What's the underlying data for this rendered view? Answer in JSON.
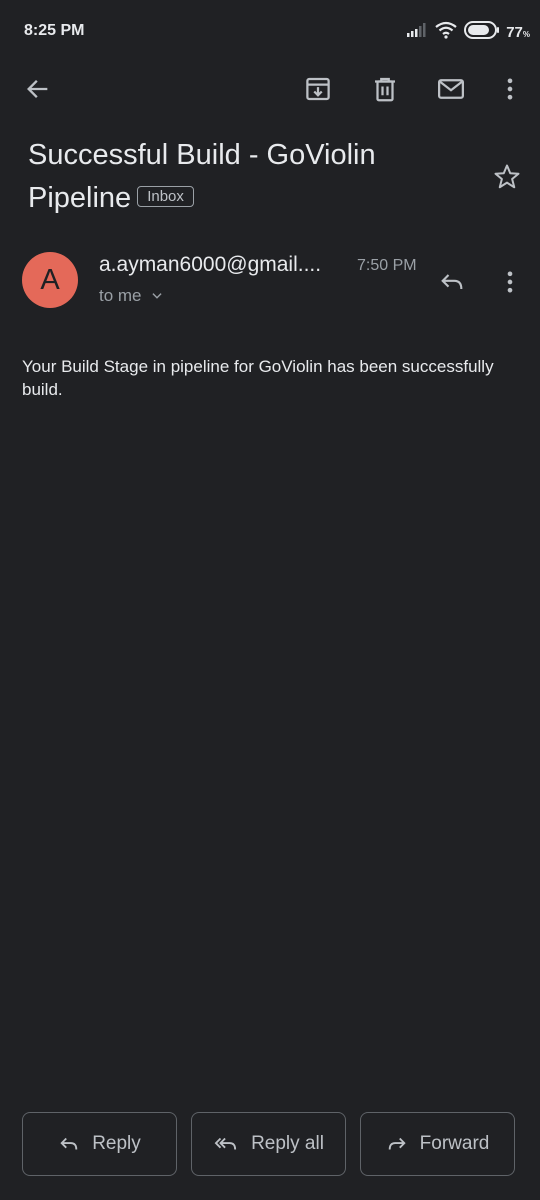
{
  "status_bar": {
    "time": "8:25 PM",
    "battery_percent": "77",
    "battery_unit": "%",
    "icons": [
      "signal-icon",
      "wifi-icon",
      "battery-icon"
    ]
  },
  "toolbar": {
    "icons": [
      "back-arrow-icon",
      "archive-icon",
      "delete-icon",
      "mark-unread-icon",
      "more-vert-icon"
    ]
  },
  "email": {
    "subject": "Successful Build - GoViolin Pipeline",
    "label": "Inbox",
    "avatar_letter": "A",
    "sender": "a.ayman6000@gmail....",
    "time": "7:50 PM",
    "recipient": "to me",
    "body": "Your Build Stage in pipeline for GoViolin has been successfully build."
  },
  "actions": {
    "reply": "Reply",
    "reply_all": "Reply all",
    "forward": "Forward"
  },
  "colors": {
    "background": "#202124",
    "text": "#e8eaed",
    "secondary_text": "#9aa0a6",
    "avatar": "#e46959",
    "border": "#5f6368"
  }
}
